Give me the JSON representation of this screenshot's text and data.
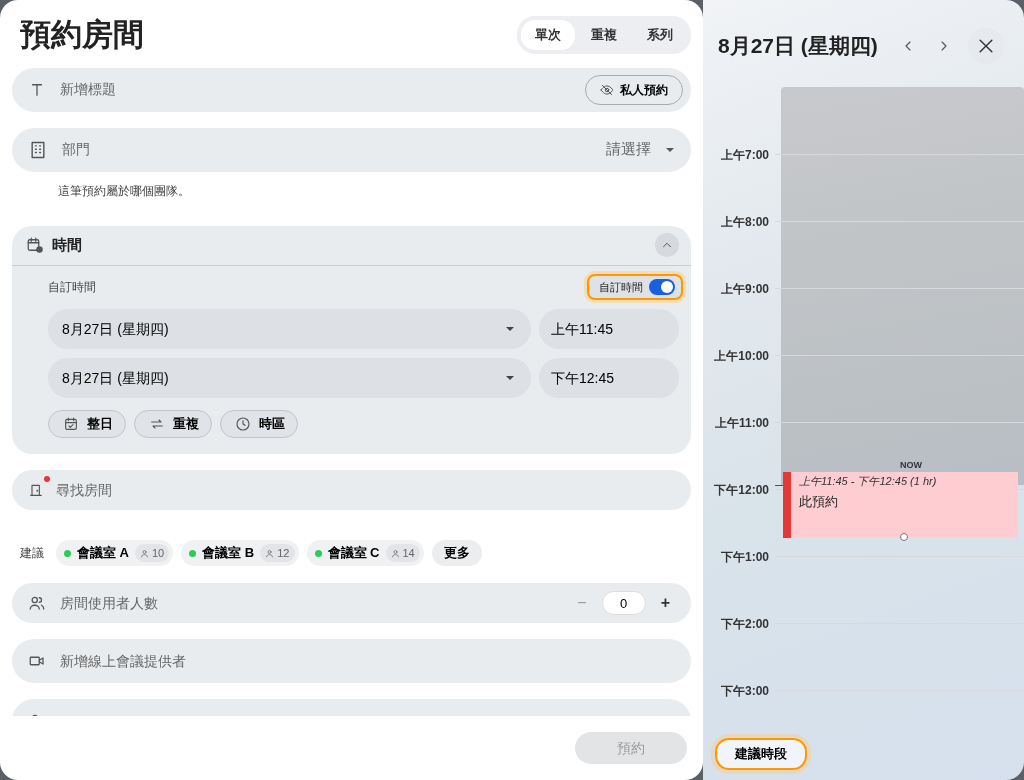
{
  "title": "預約房間",
  "mode_tabs": [
    {
      "label": "單次",
      "selected": true
    },
    {
      "label": "重複",
      "selected": false
    },
    {
      "label": "系列",
      "selected": false
    }
  ],
  "title_field": {
    "placeholder": "新增標題",
    "private_button": "私人預約"
  },
  "department": {
    "label": "部門",
    "value": "請選擇",
    "hint": "這筆預約屬於哪個團隊。"
  },
  "time_section": {
    "title": "時間",
    "expanded": true,
    "custom_label": "自訂時間",
    "custom_toggle": {
      "label": "自訂時間",
      "on": true,
      "focused": true
    },
    "start": {
      "date": "8月27日 (星期四)",
      "time": "上午11:45"
    },
    "end": {
      "date": "8月27日 (星期四)",
      "time": "下午12:45"
    },
    "options": [
      {
        "label": "整日",
        "kind": "all-day"
      },
      {
        "label": "重複",
        "kind": "repeat"
      },
      {
        "label": "時區",
        "kind": "timezone"
      }
    ]
  },
  "room_search": {
    "placeholder": "尋找房間",
    "required": true
  },
  "suggestions": {
    "label": "建議",
    "rooms": [
      {
        "name": "會議室 A",
        "capacity": "10",
        "color": "#2ecc55"
      },
      {
        "name": "會議室 B",
        "capacity": "12",
        "color": "#2ecc55"
      },
      {
        "name": "會議室 C",
        "capacity": "14",
        "color": "#2ecc55"
      }
    ],
    "more": "更多"
  },
  "attendee_count": {
    "label": "房間使用者人數",
    "minus": "−",
    "value": "0",
    "plus": "+"
  },
  "online_meeting": {
    "label": "新增線上會議提供者"
  },
  "submit": {
    "label": "預約",
    "disabled": true
  },
  "calendar": {
    "date": "8月27日 (星期四)",
    "hours": [
      "上午7:00",
      "上午8:00",
      "上午9:00",
      "上午10:00",
      "上午11:00",
      "下午12:00",
      "下午1:00",
      "下午2:00",
      "下午3:00"
    ],
    "now_label": "NOW",
    "event": {
      "time": "上午11:45 - 下午12:45 (1 hr)",
      "title": "此預約",
      "color": "#e53935"
    },
    "suggest_button": {
      "label": "建議時段",
      "focused": true
    }
  }
}
